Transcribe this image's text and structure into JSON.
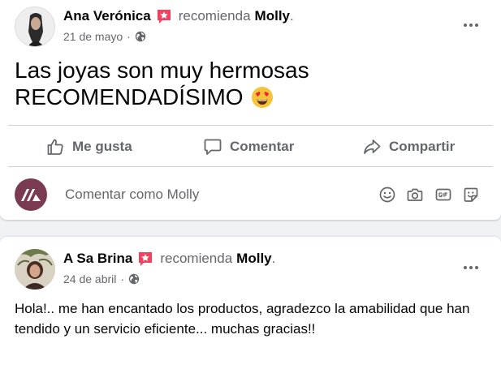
{
  "posts": [
    {
      "author": "Ana Verónica",
      "recommends_text": "recomienda",
      "page_name": "Molly",
      "punct": ".",
      "date": "21 de mayo",
      "date_sep": "·",
      "privacy_icon": "globe-icon",
      "text_line1": "Las joyas son muy hermosas",
      "text_line2": "RECOMENDADÍSIMO",
      "emoji": "heart-eyes-emoji"
    },
    {
      "author": "A Sa Brina",
      "recommends_text": "recomienda",
      "page_name": "Molly",
      "punct": ".",
      "date": "24 de abril",
      "date_sep": "·",
      "privacy_icon": "globe-icon",
      "text": "Hola!.. me han encantado los productos, agradezco la amabilidad que han tendido y un servicio eficiente... muchas gracias!!"
    }
  ],
  "actions": {
    "like_label": "Me gusta",
    "comment_label": "Comentar",
    "share_label": "Compartir"
  },
  "comment_box": {
    "placeholder": "Comentar como Molly",
    "icons": [
      "emoji-icon",
      "camera-icon",
      "gif-icon",
      "sticker-icon"
    ]
  },
  "colors": {
    "recommend_badge": "#f3425f",
    "secondary_text": "#65676b",
    "page_avatar": "#7a3b52"
  }
}
